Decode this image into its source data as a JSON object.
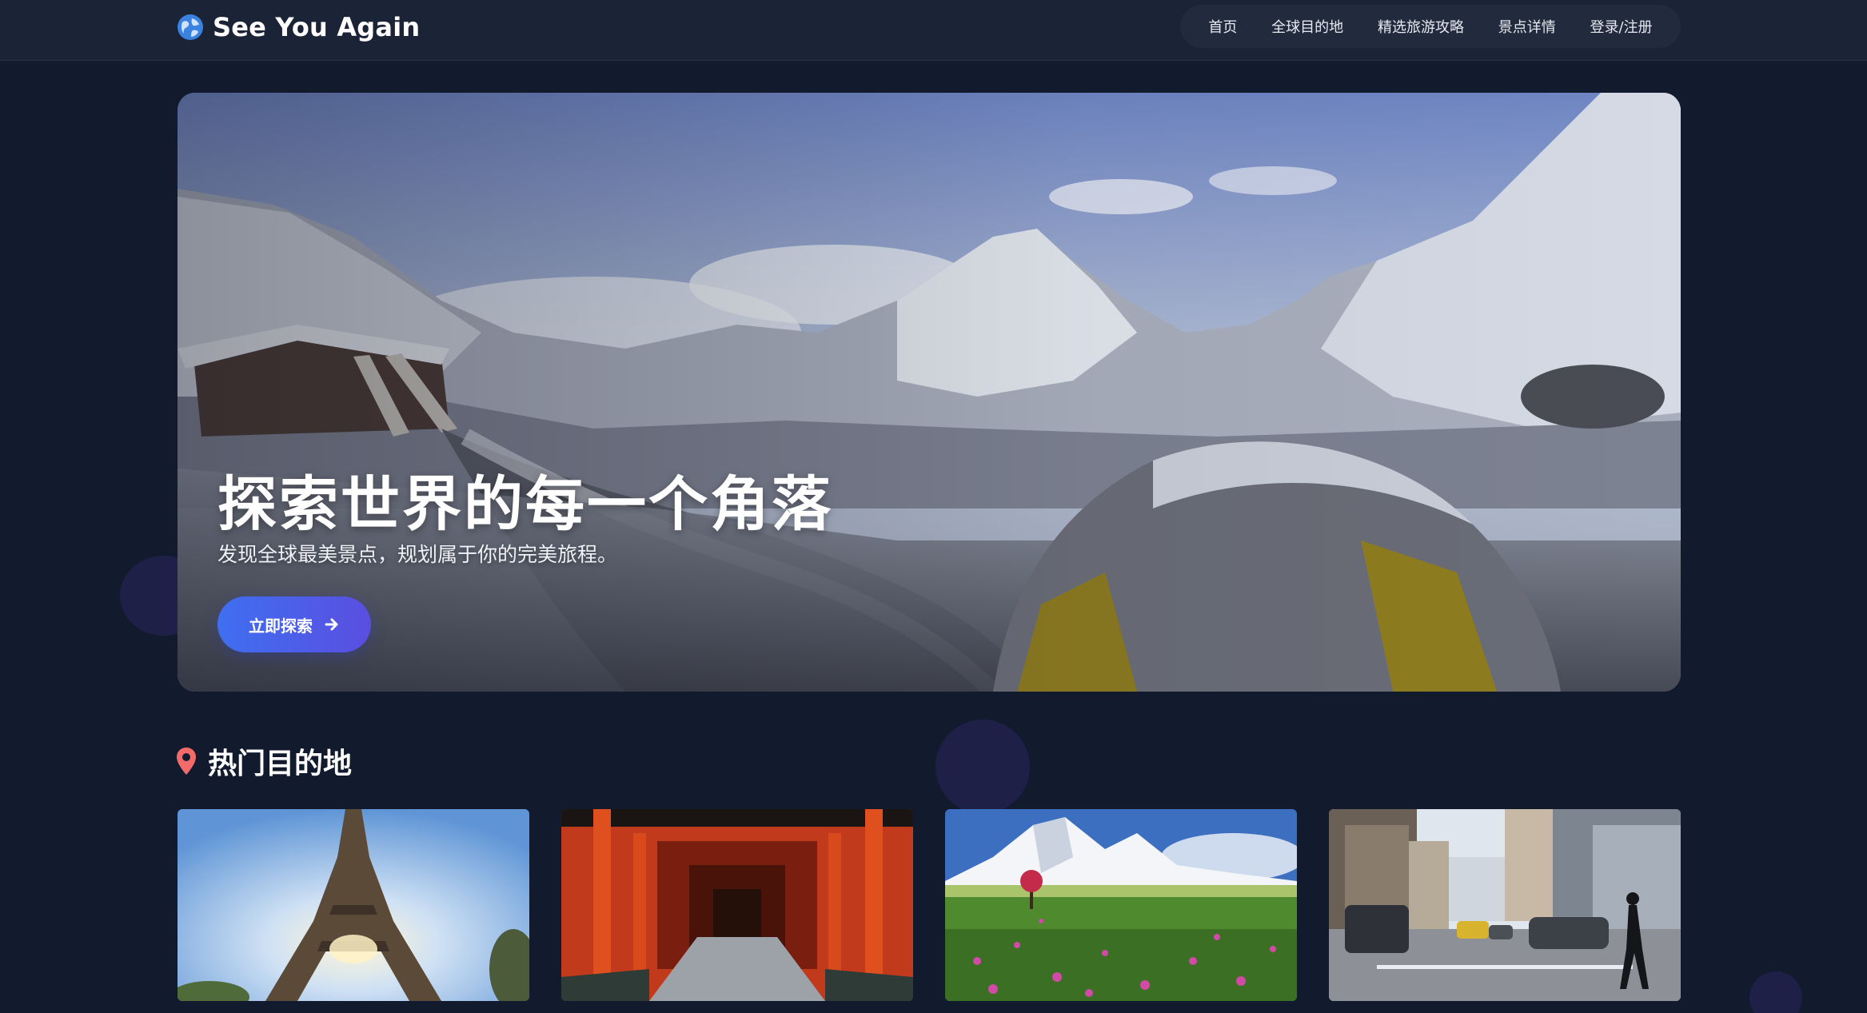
{
  "header": {
    "brand": "See You Again",
    "logo_icon": "globe-icon",
    "nav": [
      {
        "label": "首页"
      },
      {
        "label": "全球目的地"
      },
      {
        "label": "精选旅游攻略"
      },
      {
        "label": "景点详情"
      },
      {
        "label": "登录/注册"
      }
    ]
  },
  "hero": {
    "title": "探索世界的每一个角落",
    "subtitle": "发现全球最美景点，规划属于你的完美旅程。",
    "cta_label": "立即探索",
    "cta_icon": "arrow-right-icon",
    "image": "snowy-mountain-camp"
  },
  "section": {
    "title": "热门目的地",
    "icon": "map-pin-icon",
    "icon_color": "#f26b6b"
  },
  "cards": [
    {
      "image": "eiffel-tower"
    },
    {
      "image": "torii-gates"
    },
    {
      "image": "snowy-mountain-flower-field"
    },
    {
      "image": "city-street"
    }
  ],
  "colors": {
    "background": "#121a2e",
    "header": "#1b2436",
    "accent_start": "#3f6ff0",
    "accent_end": "#5a4ee0"
  }
}
